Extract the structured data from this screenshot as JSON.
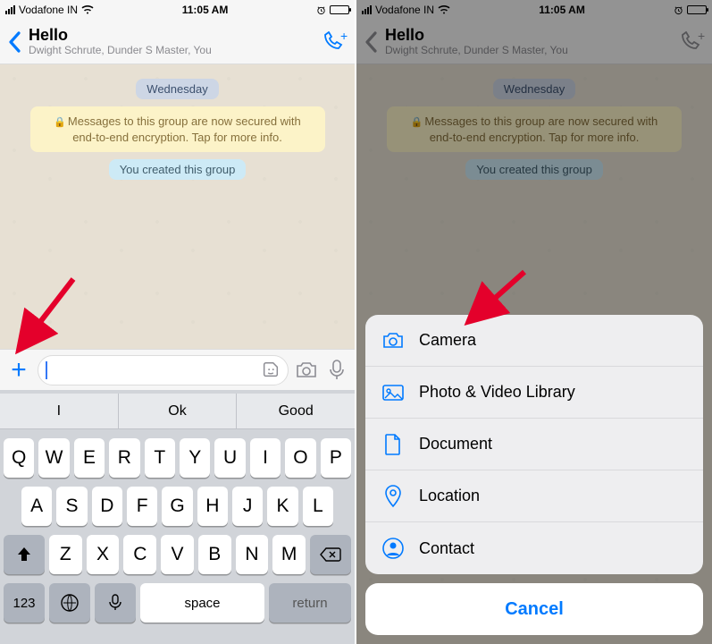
{
  "status": {
    "carrier": "Vodafone IN",
    "time": "11:05 AM"
  },
  "chat": {
    "title": "Hello",
    "subtitle": "Dwight Schrute, Dunder S Master, You",
    "date_chip": "Wednesday",
    "encryption_notice": "Messages to this group are now secured with end-to-end encryption. Tap for more info.",
    "created_chip": "You created this group"
  },
  "input": {
    "placeholder": ""
  },
  "keyboard": {
    "suggestions": [
      "I",
      "Ok",
      "Good"
    ],
    "row1": [
      "Q",
      "W",
      "E",
      "R",
      "T",
      "Y",
      "U",
      "I",
      "O",
      "P"
    ],
    "row2": [
      "A",
      "S",
      "D",
      "F",
      "G",
      "H",
      "J",
      "K",
      "L"
    ],
    "row3": [
      "Z",
      "X",
      "C",
      "V",
      "B",
      "N",
      "M"
    ],
    "space_label": "space",
    "return_label": "return",
    "num_label": "123"
  },
  "sheet": {
    "items": [
      {
        "label": "Camera",
        "icon": "camera-icon"
      },
      {
        "label": "Photo & Video Library",
        "icon": "gallery-icon"
      },
      {
        "label": "Document",
        "icon": "document-icon"
      },
      {
        "label": "Location",
        "icon": "location-icon"
      },
      {
        "label": "Contact",
        "icon": "contact-icon"
      }
    ],
    "cancel": "Cancel"
  }
}
